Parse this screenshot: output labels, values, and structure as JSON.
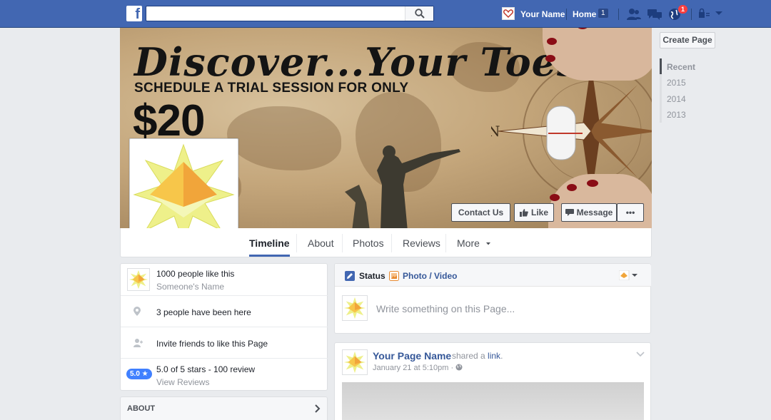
{
  "topbar": {
    "logo_letter": "f",
    "search_placeholder": "",
    "user_name": "Your Name",
    "home_label": "Home",
    "home_count": "1",
    "notification_count": "1"
  },
  "cover": {
    "title": "Discover...Your Toes",
    "subtitle": "SCHEDULE A TRIAL SESSION FOR ONLY",
    "price": "$20",
    "compass_letter": "N",
    "buttons": {
      "contact": "Contact Us",
      "like": "Like",
      "message": "Message",
      "more": "•••"
    }
  },
  "tabs": [
    {
      "label": "Timeline",
      "active": true
    },
    {
      "label": "About"
    },
    {
      "label": "Photos"
    },
    {
      "label": "Reviews"
    },
    {
      "label": "More"
    }
  ],
  "sidebar_right": {
    "create_page": "Create Page",
    "years": [
      "Recent",
      "2015",
      "2014",
      "2013"
    ]
  },
  "info": {
    "likes": "1000 people like this",
    "likes_sub": "Someone's Name",
    "checkins": "3 people have been here",
    "invite": "Invite friends to like this Page",
    "rating_badge": "5.0 ★",
    "rating": "5.0 of 5 stars - 100 review",
    "rating_link": "View Reviews",
    "about_header": "ABOUT"
  },
  "composer": {
    "status_tab": "Status",
    "photo_tab": "Photo / Video",
    "placeholder": "Write something on this Page..."
  },
  "post": {
    "page_name": "Your Page Name",
    "action_text": "shared a",
    "action_link": "link",
    "action_end": ".",
    "date": "January 21 at 5:10pm · "
  },
  "colors": {
    "fb_blue": "#4267b2",
    "link_blue": "#365899",
    "page_bg": "#e9ebee",
    "badge_red": "#fa3e3e"
  }
}
